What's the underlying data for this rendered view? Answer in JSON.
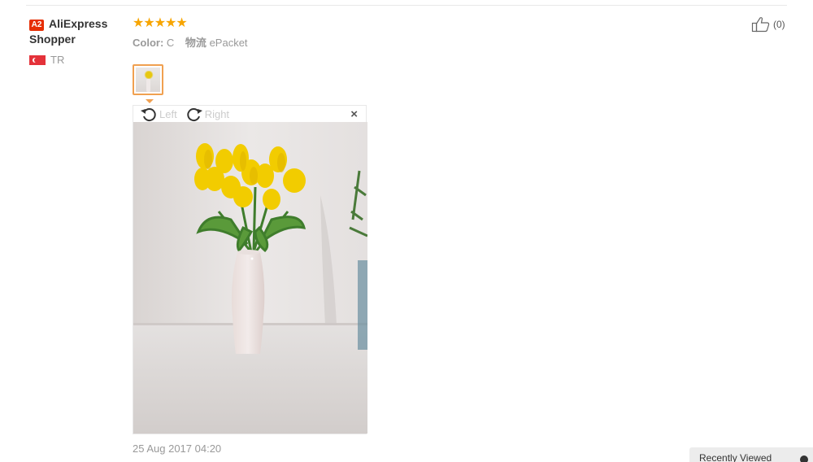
{
  "buyer": {
    "level_badge": "A2",
    "name": "AliExpress Shopper",
    "country_code": "TR",
    "flag_icon": "turkey-flag-icon"
  },
  "feedback": {
    "rating_stars": "★★★★★",
    "rating": 5,
    "star_color": "#f7a501",
    "attributes": [
      {
        "key": "Color:",
        "value": "C"
      },
      {
        "key": "物流",
        "value": "ePacket"
      }
    ],
    "image_viewer": {
      "rotate_left_label": "Left",
      "rotate_right_label": "Right",
      "close_glyph": "×"
    },
    "date": "25 Aug 2017 04:20"
  },
  "helpful": {
    "count": "(0)",
    "icon": "thumbs-up-icon"
  },
  "recently_viewed": {
    "label": "Recently Viewed"
  },
  "colors": {
    "accent": "#f0a050",
    "badge": "#e62e04",
    "muted_text": "#999999"
  }
}
